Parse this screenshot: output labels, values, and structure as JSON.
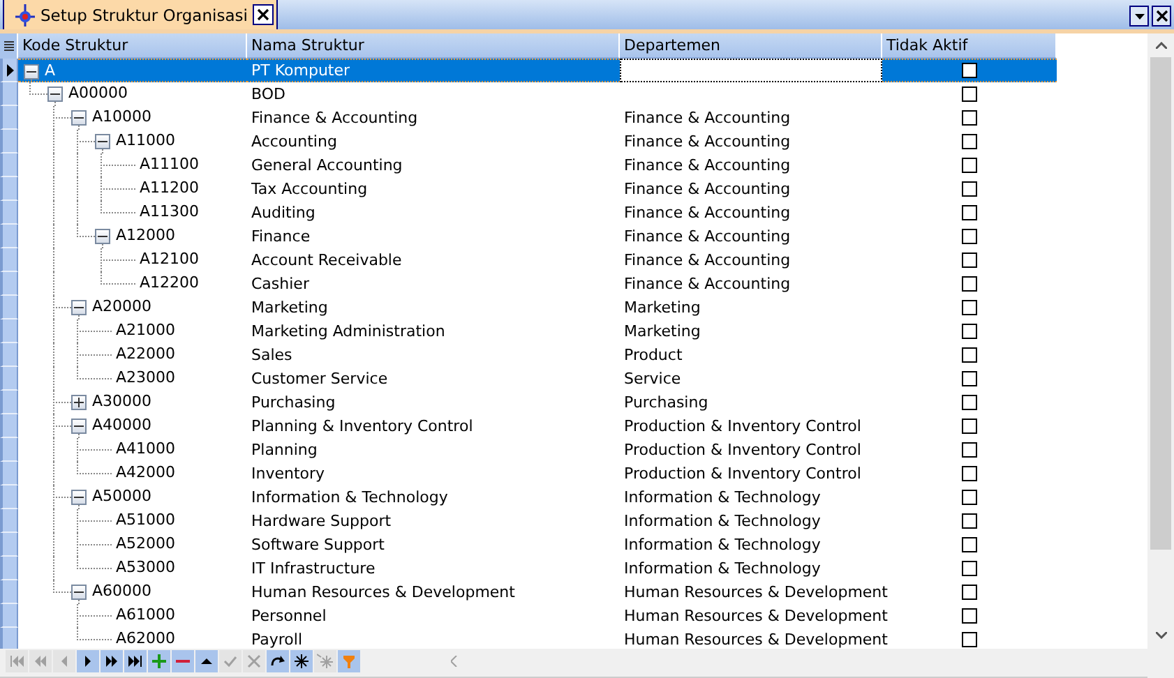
{
  "tab": {
    "title": "Setup Struktur Organisasi"
  },
  "columns": [
    "Kode Struktur",
    "Nama Struktur",
    "Departemen",
    "Tidak Aktif"
  ],
  "rows": [
    {
      "code": "A",
      "name": "PT Komputer",
      "inactive": false,
      "selected": true,
      "expanded": true,
      "children": [
        {
          "code": "A00000",
          "name": "BOD",
          "inactive": false,
          "selected": false,
          "expanded": true,
          "children": [
            {
              "code": "A10000",
              "name": "Finance & Accounting",
              "department": "Finance & Accounting",
              "inactive": false,
              "selected": false,
              "expanded": true,
              "children": [
                {
                  "code": "A11000",
                  "name": "Accounting",
                  "department": "Finance & Accounting",
                  "inactive": false,
                  "selected": false,
                  "expanded": true,
                  "children": [
                    {
                      "code": "A11100",
                      "name": "General Accounting",
                      "department": "Finance & Accounting",
                      "inactive": false,
                      "selected": false
                    },
                    {
                      "code": "A11200",
                      "name": "Tax Accounting",
                      "department": "Finance & Accounting",
                      "inactive": false,
                      "selected": false
                    },
                    {
                      "code": "A11300",
                      "name": "Auditing",
                      "department": "Finance & Accounting",
                      "inactive": false,
                      "selected": false
                    }
                  ]
                },
                {
                  "code": "A12000",
                  "name": "Finance",
                  "department": "Finance & Accounting",
                  "inactive": false,
                  "selected": false,
                  "expanded": true,
                  "children": [
                    {
                      "code": "A12100",
                      "name": "Account Receivable",
                      "department": "Finance & Accounting",
                      "inactive": false,
                      "selected": false
                    },
                    {
                      "code": "A12200",
                      "name": "Cashier",
                      "department": "Finance & Accounting",
                      "inactive": false,
                      "selected": false
                    }
                  ]
                }
              ]
            },
            {
              "code": "A20000",
              "name": "Marketing",
              "department": "Marketing",
              "inactive": false,
              "selected": false,
              "expanded": true,
              "children": [
                {
                  "code": "A21000",
                  "name": "Marketing Administration",
                  "department": "Marketing",
                  "inactive": false,
                  "selected": false
                },
                {
                  "code": "A22000",
                  "name": "Sales",
                  "department": "Product",
                  "inactive": false,
                  "selected": false
                },
                {
                  "code": "A23000",
                  "name": "Customer Service",
                  "department": "Service",
                  "inactive": false,
                  "selected": false
                }
              ]
            },
            {
              "code": "A30000",
              "name": "Purchasing",
              "department": "Purchasing",
              "inactive": false,
              "selected": false,
              "expanded": false
            },
            {
              "code": "A40000",
              "name": "Planning & Inventory Control",
              "department": "Production & Inventory Control",
              "inactive": false,
              "selected": false,
              "expanded": true,
              "children": [
                {
                  "code": "A41000",
                  "name": "Planning",
                  "department": "Production & Inventory Control",
                  "inactive": false,
                  "selected": false
                },
                {
                  "code": "A42000",
                  "name": "Inventory",
                  "department": "Production & Inventory Control",
                  "inactive": false,
                  "selected": false
                }
              ]
            },
            {
              "code": "A50000",
              "name": "Information & Technology",
              "department": "Information & Technology",
              "inactive": false,
              "selected": false,
              "expanded": true,
              "children": [
                {
                  "code": "A51000",
                  "name": "Hardware Support",
                  "department": "Information & Technology",
                  "inactive": false,
                  "selected": false
                },
                {
                  "code": "A52000",
                  "name": "Software Support",
                  "department": "Information & Technology",
                  "inactive": false,
                  "selected": false
                },
                {
                  "code": "A53000",
                  "name": "IT Infrastructure",
                  "department": "Information & Technology",
                  "inactive": false,
                  "selected": false
                }
              ]
            },
            {
              "code": "A60000",
              "name": "Human Resources & Development",
              "department": "Human Resources & Development",
              "inactive": false,
              "selected": false,
              "expanded": true,
              "children": [
                {
                  "code": "A61000",
                  "name": "Personnel",
                  "department": "Human Resources & Development",
                  "inactive": false,
                  "selected": false
                },
                {
                  "code": "A62000",
                  "name": "Payroll",
                  "department": "Human Resources & Development",
                  "inactive": false,
                  "selected": false
                }
              ]
            }
          ]
        }
      ]
    }
  ],
  "navigator": [
    {
      "kind": "first",
      "disabled": true
    },
    {
      "kind": "prior-page",
      "disabled": true
    },
    {
      "kind": "prior",
      "disabled": true
    },
    {
      "kind": "next",
      "disabled": false
    },
    {
      "kind": "next-page",
      "disabled": false
    },
    {
      "kind": "last",
      "disabled": false
    },
    {
      "kind": "insert",
      "disabled": false
    },
    {
      "kind": "delete",
      "disabled": false
    },
    {
      "kind": "edit",
      "disabled": false
    },
    {
      "kind": "post",
      "disabled": true
    },
    {
      "kind": "cancel",
      "disabled": true
    },
    {
      "kind": "refresh",
      "disabled": false
    },
    {
      "kind": "bookmark",
      "disabled": false
    },
    {
      "kind": "goto-bookmark",
      "disabled": true
    },
    {
      "kind": "filter",
      "disabled": false
    }
  ]
}
